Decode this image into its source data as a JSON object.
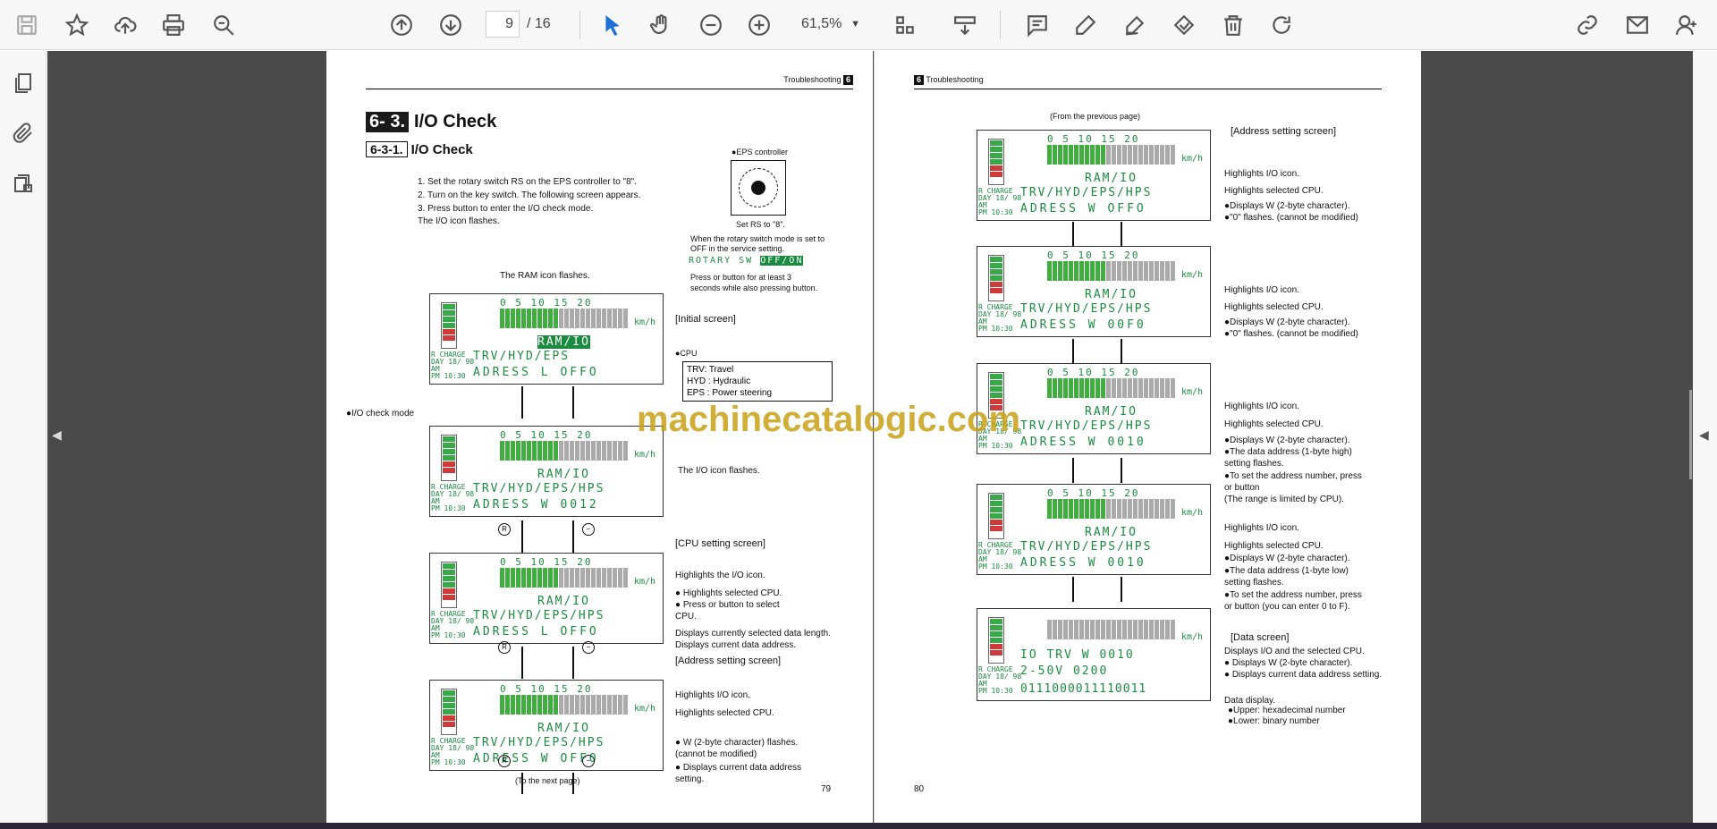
{
  "toolbar": {
    "page_current": "9",
    "page_total": "/ 16",
    "zoom": "61,5%"
  },
  "doc": {
    "left": {
      "header": "Troubleshooting",
      "header_num": "6",
      "section_num": "6- 3.",
      "section_title": "I/O Check",
      "sub_num": "6-3-1.",
      "sub_title": "I/O Check",
      "steps": [
        "1. Set the rotary switch RS on the EPS controller to \"8\".",
        "2. Turn on the key switch. The following screen appears.",
        "3. Press      button to enter the I/O check mode.",
        "    The I/O icon flashes."
      ],
      "eps_label": "●EPS controller",
      "set_rs": "Set RS to \"8\".",
      "rotary_note1": "When the rotary switch mode is set to",
      "rotary_note2": "OFF in the service setting.",
      "rotary_sw": "ROTARY SW",
      "rotary_offon": "OFF/ON",
      "press_note1": "Press      or      button for at least 3",
      "press_note2": "seconds while also pressing      button.",
      "ram_flash": "The RAM icon flashes.",
      "initial_screen": "[Initial screen]",
      "cpu_label": "●CPU",
      "cpu_box": [
        "TRV: Travel",
        "HYD : Hydraulic",
        "EPS : Power steering"
      ],
      "io_check_mode": "●I/O check mode",
      "io_icon_flashes": "The I/O icon flashes.",
      "cpu_setting": "[CPU setting screen]",
      "hl_io": "Highlights the I/O icon.",
      "hl_cpu": "● Highlights selected CPU.",
      "press_select1": "● Press      or      button to select",
      "press_select2": "   CPU.",
      "disp_len1": "Displays currently selected data length.",
      "disp_len2": "Displays current data address.",
      "addr_screen": "[Address setting screen]",
      "hl_io2": "Highlights I/O icon.",
      "hl_cpu2": "Highlights selected CPU.",
      "w_flash1": "● W (2-byte character) flashes.",
      "w_flash2": "   (cannot be modified)",
      "disp_addr1": "● Displays current data address",
      "disp_addr2": "   setting.",
      "to_next": "(To the next page)",
      "page_no": "79"
    },
    "right": {
      "header": "Troubleshooting",
      "header_num": "6",
      "from_prev": "(From the previous page)",
      "addr_screen": "[Address setting screen]",
      "hl_io": "Highlights I/O icon.",
      "hl_cpu": "Highlights selected CPU.",
      "disp_w": "●Displays W (2-byte character).",
      "zero_flash": "●\"0\" flashes. (cannot be modified)",
      "data_addr_high1": "●The data address (1-byte high)",
      "data_addr_high2": "   setting flashes.",
      "set_addr1": "●To set the address number, press",
      "set_addr2": "      or      button",
      "set_addr3": "   (The range is limited by CPU).",
      "data_addr_low1": "●The data address (1-byte low)",
      "data_addr_low2": "   setting flashes.",
      "set_addr_low1": "●To set the address number, press",
      "set_addr_low2": "   or      button (you can enter 0 to F).",
      "data_screen": "[Data screen]",
      "disp_io_cpu": "Displays I/O and the selected CPU.",
      "disp_w2": "● Displays W (2-byte character).",
      "disp_cur": "● Displays current data address setting.",
      "data_disp": "Data display.",
      "upper": "●Upper: hexadecimal number",
      "lower": "●Lower: binary number",
      "page_no": "80"
    },
    "lcd": {
      "scale": "0  5  10 15 20",
      "kmh": "km/h",
      "side": [
        "R CHARGE",
        "DAY 18/ 98",
        "AM",
        "PM 10:30"
      ],
      "ram_io": "RAM/IO",
      "cpu_line": "TRV/HYD/EPS",
      "cpu_line2": "TRV/HYD/EPS/HPS",
      "addr_l": "ADRESS  L OFFO",
      "addr_w": "ADRESS  W 0012",
      "addr_w2": "ADRESS  W OFFO",
      "addr_w_r1": "ADRESS  W OFFO",
      "addr_w_r2": "ADRESS  W 00F0",
      "addr_w_r3": "ADRESS  W 0010",
      "addr_w_r4": "ADRESS  W 0010",
      "data_l1": "IO  TRV  W 0010",
      "data_l2": "2-50V      0200",
      "data_l3": "0111000011110011"
    },
    "watermark": "machinecatalogic.com"
  }
}
